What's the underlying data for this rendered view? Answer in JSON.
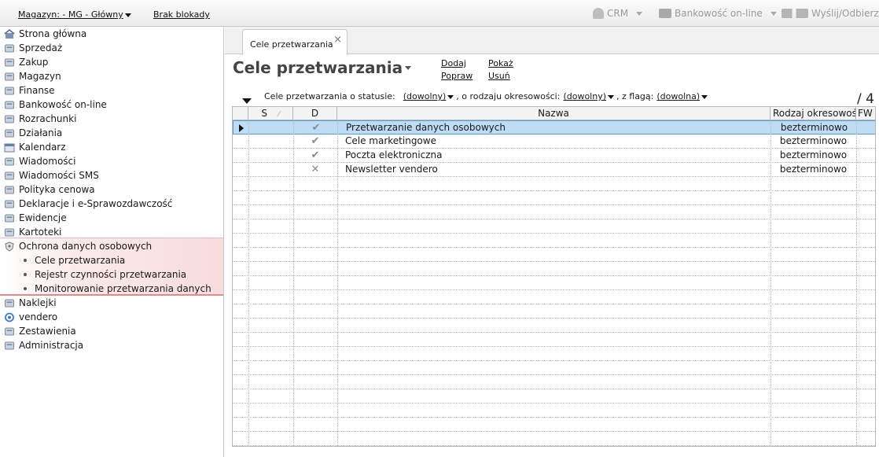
{
  "topbar": {
    "warehouse_label": "Magazyn: - MG - Główny",
    "lock_status": "Brak blokady",
    "crm": "CRM",
    "banking": "Bankowość on-line",
    "send_receive": "Wyślij/Odbierz"
  },
  "sidebar": {
    "items": [
      {
        "label": "Strona główna",
        "icon": "home-icon"
      },
      {
        "label": "Sprzedaż",
        "icon": "sales-icon"
      },
      {
        "label": "Zakup",
        "icon": "purchase-icon"
      },
      {
        "label": "Magazyn",
        "icon": "warehouse-icon"
      },
      {
        "label": "Finanse",
        "icon": "finance-icon"
      },
      {
        "label": "Bankowość on-line",
        "icon": "bank-icon"
      },
      {
        "label": "Rozrachunki",
        "icon": "settlements-icon"
      },
      {
        "label": "Działania",
        "icon": "actions-icon"
      },
      {
        "label": "Kalendarz",
        "icon": "calendar-icon"
      },
      {
        "label": "Wiadomości",
        "icon": "messages-icon"
      },
      {
        "label": "Wiadomości SMS",
        "icon": "sms-icon"
      },
      {
        "label": "Polityka cenowa",
        "icon": "pricing-icon"
      },
      {
        "label": "Deklaracje i e-Sprawozdawczość",
        "icon": "declarations-icon"
      },
      {
        "label": "Ewidencje",
        "icon": "records-icon"
      },
      {
        "label": "Kartoteki",
        "icon": "files-icon"
      },
      {
        "label": "Ochrona danych osobowych",
        "icon": "shield-icon"
      }
    ],
    "subitems": [
      "Cele przetwarzania",
      "Rejestr czynności przetwarzania",
      "Monitorowanie przetwarzania danych"
    ],
    "items_after": [
      {
        "label": "Naklejki",
        "icon": "stickers-icon"
      },
      {
        "label": "vendero",
        "icon": "vendero-icon"
      },
      {
        "label": "Zestawienia",
        "icon": "reports-icon"
      },
      {
        "label": "Administracja",
        "icon": "admin-icon"
      }
    ]
  },
  "tab": {
    "label": "Cele przetwarzania",
    "close": "×"
  },
  "page": {
    "title": "Cele przetwarzania",
    "actions": {
      "add": "Dodaj",
      "show": "Pokaż",
      "fix": "Popraw",
      "delete": "Usuń"
    }
  },
  "filters": {
    "status_label": "Cele przetwarzania o statusie:",
    "status_value": "(dowolny)",
    "period_label": ", o rodzaju okresowości:",
    "period_value": "(dowolny)",
    "flag_label": ", z flagą:",
    "flag_value": "(dowolna)"
  },
  "count": "/ 4",
  "table": {
    "columns": {
      "s": "S",
      "d": "D",
      "name": "Nazwa",
      "kind": "Rodzaj okresowości",
      "fw": "FW"
    },
    "rows": [
      {
        "d": "✔",
        "name": "Przetwarzanie danych osobowych",
        "kind": "bezterminowo",
        "selected": true
      },
      {
        "d": "✔",
        "name": "Cele marketingowe",
        "kind": "bezterminowo",
        "selected": false
      },
      {
        "d": "✔",
        "name": "Poczta elektroniczna",
        "kind": "bezterminowo",
        "selected": false
      },
      {
        "d": "✕",
        "name": "Newsletter vendero",
        "kind": "bezterminowo",
        "selected": false
      }
    ],
    "empty_rows": 19
  }
}
